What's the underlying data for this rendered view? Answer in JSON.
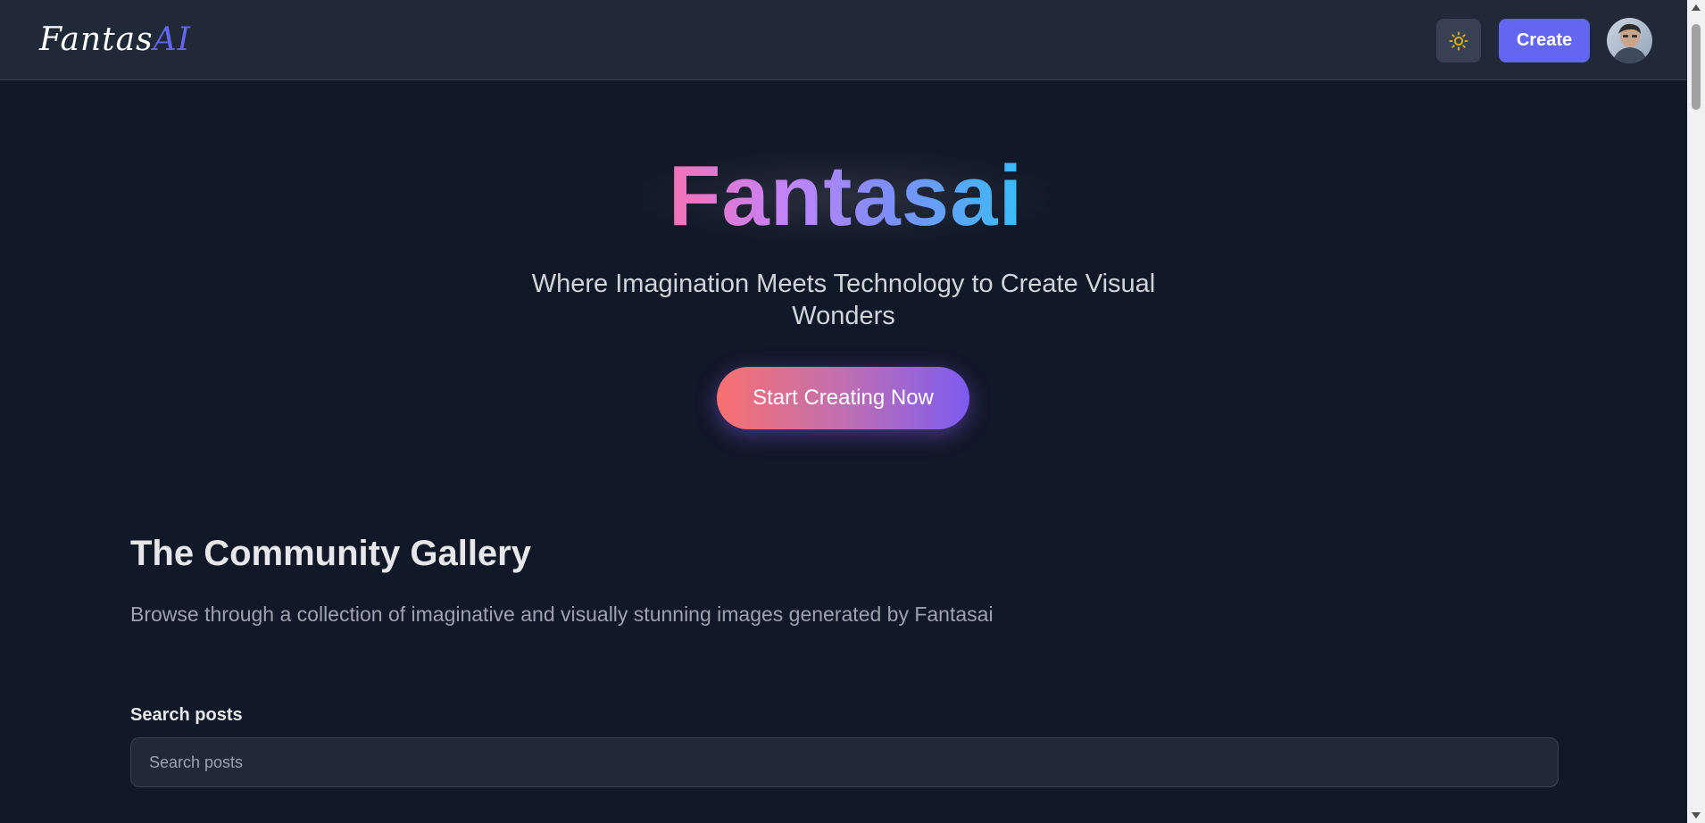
{
  "header": {
    "logo_part1": "Fantas",
    "logo_part2": "AI",
    "theme_toggle_icon": "sun-icon",
    "create_label": "Create",
    "avatar_icon": "user-avatar"
  },
  "hero": {
    "title": "Fantasai",
    "subtitle": "Where Imagination Meets Technology to Create Visual Wonders",
    "cta_label": "Start Creating Now"
  },
  "gallery": {
    "title": "The Community Gallery",
    "description": "Browse through a collection of imaginative and visually stunning images generated by Fantasai",
    "search_label": "Search posts",
    "search_placeholder": "Search posts",
    "search_value": ""
  },
  "colors": {
    "background": "#111827",
    "header_bg": "#1f2937",
    "accent": "#6366f1",
    "sun_icon": "#eab308"
  }
}
